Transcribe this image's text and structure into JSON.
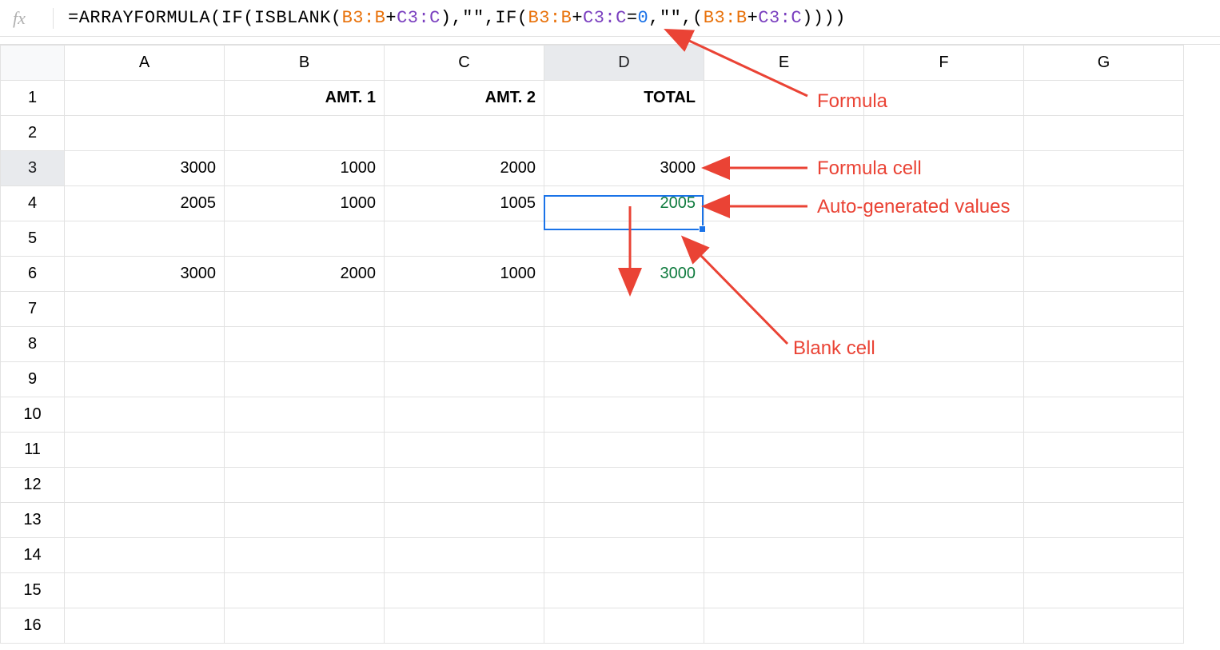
{
  "formula_bar": {
    "fx": "fx",
    "segments": [
      {
        "t": "plain",
        "v": "=ARRAYFORMULA(IF(ISBLANK("
      },
      {
        "t": "rng1",
        "v": "B3:B"
      },
      {
        "t": "plain",
        "v": "+"
      },
      {
        "t": "rng2",
        "v": "C3:C"
      },
      {
        "t": "plain",
        "v": "),\"\",IF("
      },
      {
        "t": "rng1",
        "v": "B3:B"
      },
      {
        "t": "plain",
        "v": "+"
      },
      {
        "t": "rng2",
        "v": "C3:C"
      },
      {
        "t": "plain",
        "v": "="
      },
      {
        "t": "num",
        "v": "0"
      },
      {
        "t": "plain",
        "v": ",\"\",("
      },
      {
        "t": "rng1",
        "v": "B3:B"
      },
      {
        "t": "plain",
        "v": "+"
      },
      {
        "t": "rng2",
        "v": "C3:C"
      },
      {
        "t": "plain",
        "v": "))))"
      }
    ]
  },
  "columns": [
    "A",
    "B",
    "C",
    "D",
    "E",
    "F",
    "G"
  ],
  "selected_column_index": 3,
  "selected_row_index": 2,
  "rows": [
    {
      "hdr": "1",
      "cells": [
        {
          "v": "",
          "cls": ""
        },
        {
          "v": "AMT. 1",
          "cls": "header-cell"
        },
        {
          "v": "AMT. 2",
          "cls": "header-cell"
        },
        {
          "v": "TOTAL",
          "cls": "header-cell"
        },
        {
          "v": "",
          "cls": ""
        },
        {
          "v": "",
          "cls": ""
        },
        {
          "v": "",
          "cls": ""
        }
      ]
    },
    {
      "hdr": "2",
      "cells": [
        {
          "v": ""
        },
        {
          "v": ""
        },
        {
          "v": ""
        },
        {
          "v": ""
        },
        {
          "v": ""
        },
        {
          "v": ""
        },
        {
          "v": ""
        }
      ]
    },
    {
      "hdr": "3",
      "cells": [
        {
          "v": "3000"
        },
        {
          "v": "1000"
        },
        {
          "v": "2000"
        },
        {
          "v": "3000",
          "cls": ""
        },
        {
          "v": ""
        },
        {
          "v": ""
        },
        {
          "v": ""
        }
      ]
    },
    {
      "hdr": "4",
      "cells": [
        {
          "v": "2005"
        },
        {
          "v": "1000"
        },
        {
          "v": "1005"
        },
        {
          "v": "2005",
          "cls": "auto-val"
        },
        {
          "v": ""
        },
        {
          "v": ""
        },
        {
          "v": ""
        }
      ]
    },
    {
      "hdr": "5",
      "cells": [
        {
          "v": ""
        },
        {
          "v": ""
        },
        {
          "v": ""
        },
        {
          "v": ""
        },
        {
          "v": ""
        },
        {
          "v": ""
        },
        {
          "v": ""
        }
      ]
    },
    {
      "hdr": "6",
      "cells": [
        {
          "v": "3000"
        },
        {
          "v": "2000"
        },
        {
          "v": "1000"
        },
        {
          "v": "3000",
          "cls": "auto-val"
        },
        {
          "v": ""
        },
        {
          "v": ""
        },
        {
          "v": ""
        }
      ]
    },
    {
      "hdr": "7",
      "cells": [
        {
          "v": ""
        },
        {
          "v": ""
        },
        {
          "v": ""
        },
        {
          "v": ""
        },
        {
          "v": ""
        },
        {
          "v": ""
        },
        {
          "v": ""
        }
      ]
    },
    {
      "hdr": "8",
      "cells": [
        {
          "v": ""
        },
        {
          "v": ""
        },
        {
          "v": ""
        },
        {
          "v": ""
        },
        {
          "v": ""
        },
        {
          "v": ""
        },
        {
          "v": ""
        }
      ]
    },
    {
      "hdr": "9",
      "cells": [
        {
          "v": ""
        },
        {
          "v": ""
        },
        {
          "v": ""
        },
        {
          "v": ""
        },
        {
          "v": ""
        },
        {
          "v": ""
        },
        {
          "v": ""
        }
      ]
    },
    {
      "hdr": "10",
      "cells": [
        {
          "v": ""
        },
        {
          "v": ""
        },
        {
          "v": ""
        },
        {
          "v": ""
        },
        {
          "v": ""
        },
        {
          "v": ""
        },
        {
          "v": ""
        }
      ]
    },
    {
      "hdr": "11",
      "cells": [
        {
          "v": ""
        },
        {
          "v": ""
        },
        {
          "v": ""
        },
        {
          "v": ""
        },
        {
          "v": ""
        },
        {
          "v": ""
        },
        {
          "v": ""
        }
      ]
    },
    {
      "hdr": "12",
      "cells": [
        {
          "v": ""
        },
        {
          "v": ""
        },
        {
          "v": ""
        },
        {
          "v": ""
        },
        {
          "v": ""
        },
        {
          "v": ""
        },
        {
          "v": ""
        }
      ]
    },
    {
      "hdr": "13",
      "cells": [
        {
          "v": ""
        },
        {
          "v": ""
        },
        {
          "v": ""
        },
        {
          "v": ""
        },
        {
          "v": ""
        },
        {
          "v": ""
        },
        {
          "v": ""
        }
      ]
    },
    {
      "hdr": "14",
      "cells": [
        {
          "v": ""
        },
        {
          "v": ""
        },
        {
          "v": ""
        },
        {
          "v": ""
        },
        {
          "v": ""
        },
        {
          "v": ""
        },
        {
          "v": ""
        }
      ]
    },
    {
      "hdr": "15",
      "cells": [
        {
          "v": ""
        },
        {
          "v": ""
        },
        {
          "v": ""
        },
        {
          "v": ""
        },
        {
          "v": ""
        },
        {
          "v": ""
        },
        {
          "v": ""
        }
      ]
    },
    {
      "hdr": "16",
      "cells": [
        {
          "v": ""
        },
        {
          "v": ""
        },
        {
          "v": ""
        },
        {
          "v": ""
        },
        {
          "v": ""
        },
        {
          "v": ""
        },
        {
          "v": ""
        }
      ]
    }
  ],
  "annotations": {
    "formula": "Formula",
    "formula_cell": "Formula cell",
    "auto_generated": "Auto-generated values",
    "blank_cell": "Blank cell"
  },
  "chart_data": {
    "type": "table",
    "note": "Spreadsheet cell values",
    "columns": [
      "A",
      "B (AMT. 1)",
      "C (AMT. 2)",
      "D (TOTAL)"
    ],
    "rows": [
      {
        "row": 3,
        "A": 3000,
        "B": 1000,
        "C": 2000,
        "D": 3000
      },
      {
        "row": 4,
        "A": 2005,
        "B": 1000,
        "C": 1005,
        "D": 2005
      },
      {
        "row": 5,
        "A": null,
        "B": null,
        "C": null,
        "D": null
      },
      {
        "row": 6,
        "A": 3000,
        "B": 2000,
        "C": 1000,
        "D": 3000
      }
    ]
  }
}
